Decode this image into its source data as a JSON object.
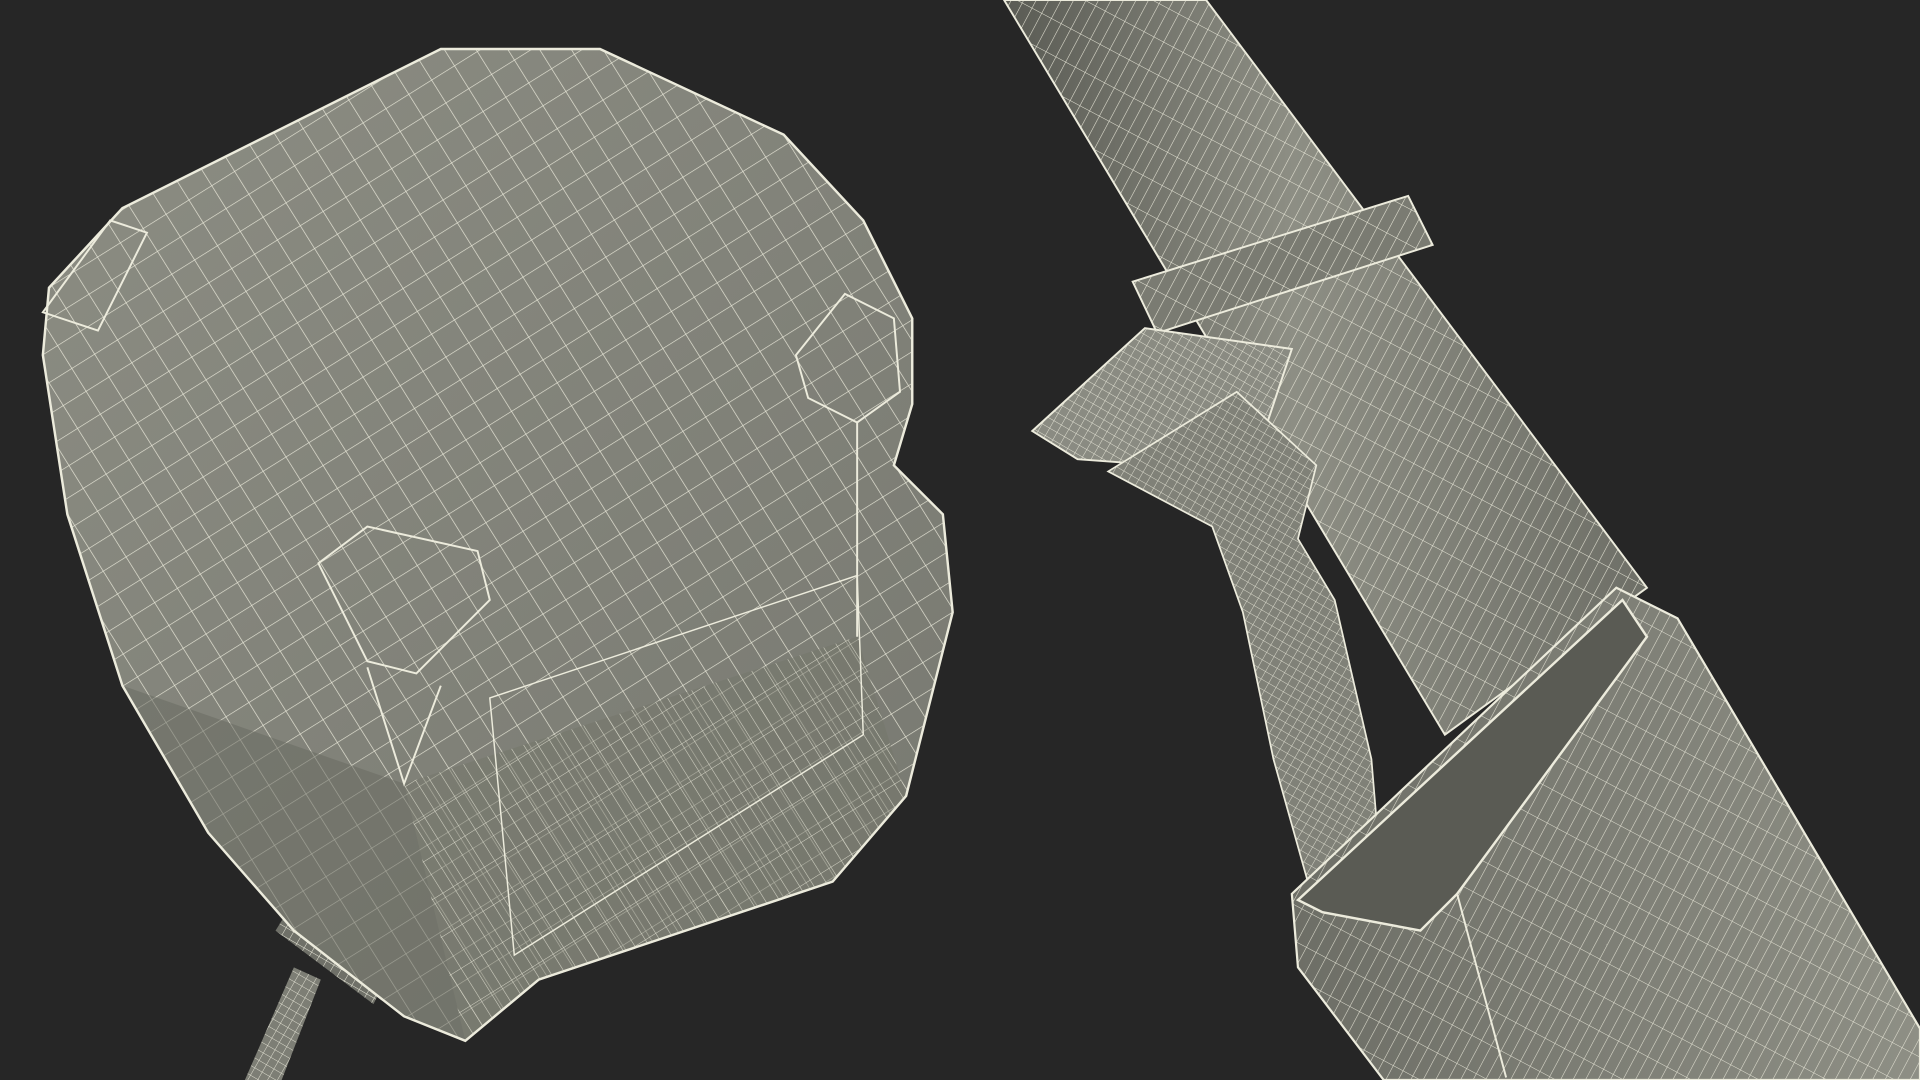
{
  "scene": {
    "background_color": "#262626",
    "mesh_surface_color": "#82837a",
    "mesh_shadow_color": "#55564f",
    "wire_color": "#ecebdc",
    "objects": [
      {
        "name": "housing-block",
        "description_visible": false
      },
      {
        "name": "pole-with-clip-and-sleeve",
        "description_visible": false
      }
    ]
  }
}
